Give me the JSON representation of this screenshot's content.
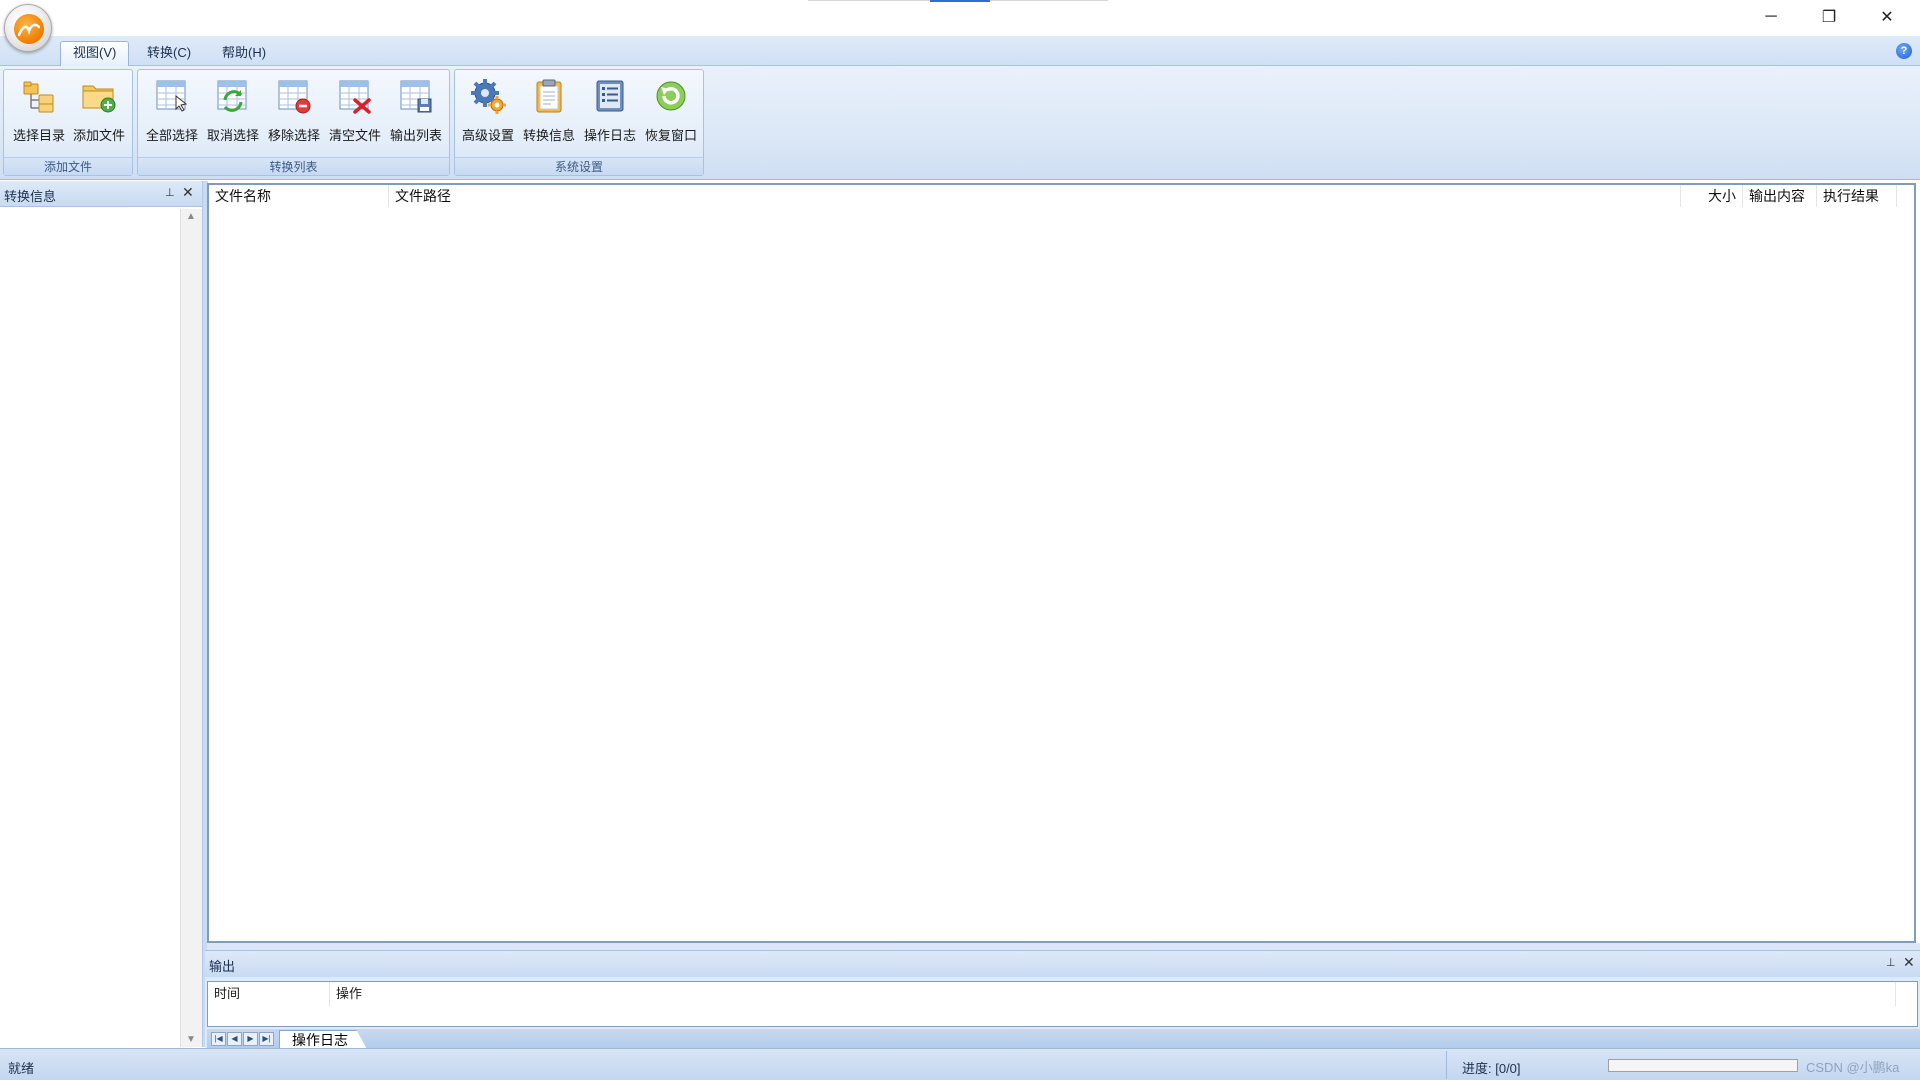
{
  "window": {
    "controls": {
      "minimize": "─",
      "maximize": "❐",
      "close": "✕"
    }
  },
  "menu_tabs": [
    {
      "label": "视图(V)",
      "active": true
    },
    {
      "label": "转换(C)",
      "active": false
    },
    {
      "label": "帮助(H)",
      "active": false
    }
  ],
  "help_button": "?",
  "ribbon": {
    "groups": [
      {
        "label": "添加文件",
        "buttons": [
          {
            "label": "选择目录",
            "icon": "folder-tree-icon"
          },
          {
            "label": "添加文件",
            "icon": "folder-add-icon"
          }
        ]
      },
      {
        "label": "转换列表",
        "buttons": [
          {
            "label": "全部选择",
            "icon": "select-all-icon"
          },
          {
            "label": "取消选择",
            "icon": "deselect-icon"
          },
          {
            "label": "移除选择",
            "icon": "remove-selected-icon"
          },
          {
            "label": "清空文件",
            "icon": "clear-files-icon"
          },
          {
            "label": "输出列表",
            "icon": "export-list-icon"
          }
        ]
      },
      {
        "label": "系统设置",
        "buttons": [
          {
            "label": "高级设置",
            "icon": "gears-icon"
          },
          {
            "label": "转换信息",
            "icon": "clipboard-icon"
          },
          {
            "label": "操作日志",
            "icon": "log-list-icon"
          },
          {
            "label": "恢复窗口",
            "icon": "restore-arrow-icon"
          }
        ]
      }
    ]
  },
  "left_panel": {
    "title": "转换信息",
    "pin": "⊥",
    "close": "✕"
  },
  "file_list": {
    "columns": [
      "文件名称",
      "文件路径",
      "大小",
      "输出内容",
      "执行结果"
    ],
    "rows": []
  },
  "output_panel": {
    "title": "输出",
    "pin": "⊥",
    "close": "✕",
    "columns": [
      "时间",
      "操作"
    ],
    "sheet_tab": "操作日志",
    "nav": {
      "first": "|◀",
      "prev": "◀",
      "next": "▶",
      "last": "▶|"
    }
  },
  "status": {
    "ready": "就绪",
    "progress_label": "进度: [0/0]",
    "progress_fraction": 0,
    "watermark": "CSDN @小鹏ka"
  },
  "colors": {
    "accent": "#2a6fd6",
    "ribbon_bg": "#dce8f7",
    "border": "#a9c2e3"
  }
}
